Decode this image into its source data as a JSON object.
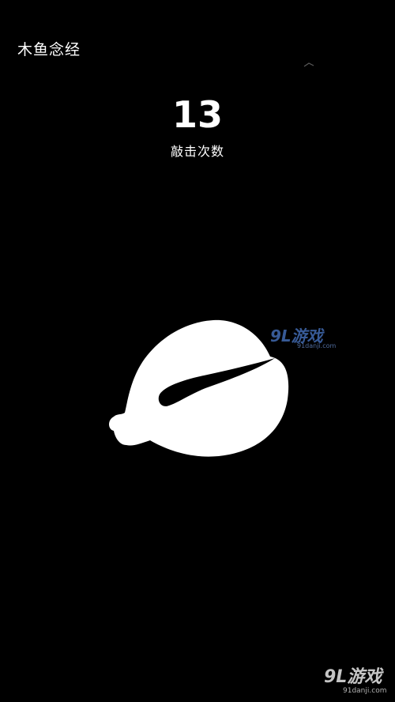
{
  "app": {
    "title": "木鱼念经"
  },
  "counter": {
    "value": "13",
    "label": "敲击次数"
  },
  "muyu": {
    "icon": "wooden-fish-icon",
    "color": "#ffffff"
  },
  "watermarks": {
    "center": {
      "logo": "9L游戏",
      "sub": "91danji.com"
    },
    "corner": {
      "logo": "9L游戏",
      "sub": "91danji.com"
    }
  },
  "colors": {
    "background": "#000000",
    "foreground": "#ffffff"
  }
}
